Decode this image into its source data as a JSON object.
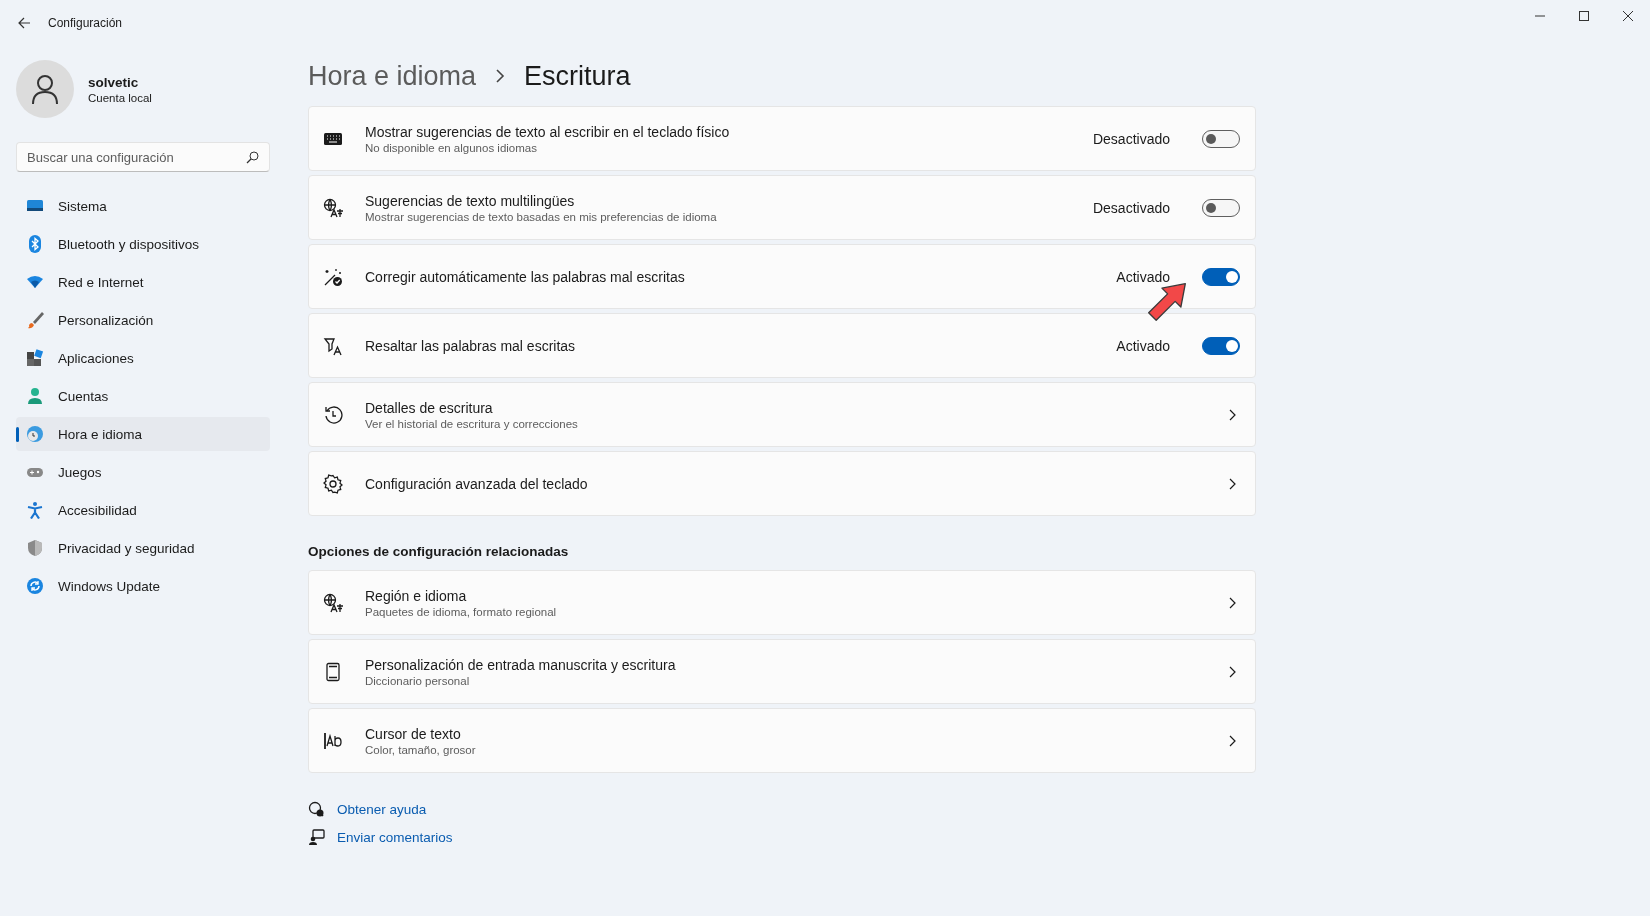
{
  "window": {
    "title": "Configuración"
  },
  "user": {
    "name": "solvetic",
    "account": "Cuenta local"
  },
  "search": {
    "placeholder": "Buscar una configuración"
  },
  "nav": [
    {
      "label": "Sistema",
      "selected": false
    },
    {
      "label": "Bluetooth y dispositivos",
      "selected": false
    },
    {
      "label": "Red e Internet",
      "selected": false
    },
    {
      "label": "Personalización",
      "selected": false
    },
    {
      "label": "Aplicaciones",
      "selected": false
    },
    {
      "label": "Cuentas",
      "selected": false
    },
    {
      "label": "Hora e idioma",
      "selected": true
    },
    {
      "label": "Juegos",
      "selected": false
    },
    {
      "label": "Accesibilidad",
      "selected": false
    },
    {
      "label": "Privacidad y seguridad",
      "selected": false
    },
    {
      "label": "Windows Update",
      "selected": false
    }
  ],
  "breadcrumb": {
    "parent": "Hora e idioma",
    "current": "Escritura"
  },
  "settings": [
    {
      "kind": "toggle",
      "title": "Mostrar sugerencias de texto al escribir en el teclado físico",
      "subtitle": "No disponible en algunos idiomas",
      "state_label": "Desactivado",
      "on": false
    },
    {
      "kind": "toggle",
      "title": "Sugerencias de texto multilingües",
      "subtitle": "Mostrar sugerencias de texto basadas en mis preferencias de idioma",
      "state_label": "Desactivado",
      "on": false
    },
    {
      "kind": "toggle",
      "title": "Corregir automáticamente las palabras mal escritas",
      "state_label": "Activado",
      "on": true
    },
    {
      "kind": "toggle",
      "title": "Resaltar las palabras mal escritas",
      "state_label": "Activado",
      "on": true
    },
    {
      "kind": "link",
      "title": "Detalles de escritura",
      "subtitle": "Ver el historial de escritura y correcciones"
    },
    {
      "kind": "link",
      "title": "Configuración avanzada del teclado"
    }
  ],
  "related": {
    "heading": "Opciones de configuración relacionadas",
    "items": [
      {
        "kind": "link",
        "title": "Región e idioma",
        "subtitle": "Paquetes de idioma, formato regional"
      },
      {
        "kind": "link",
        "title": "Personalización de entrada manuscrita y escritura",
        "subtitle": "Diccionario personal"
      },
      {
        "kind": "link",
        "title": "Cursor de texto",
        "subtitle": "Color, tamaño, grosor"
      }
    ]
  },
  "links": [
    {
      "label": "Obtener ayuda"
    },
    {
      "label": "Enviar comentarios"
    }
  ]
}
